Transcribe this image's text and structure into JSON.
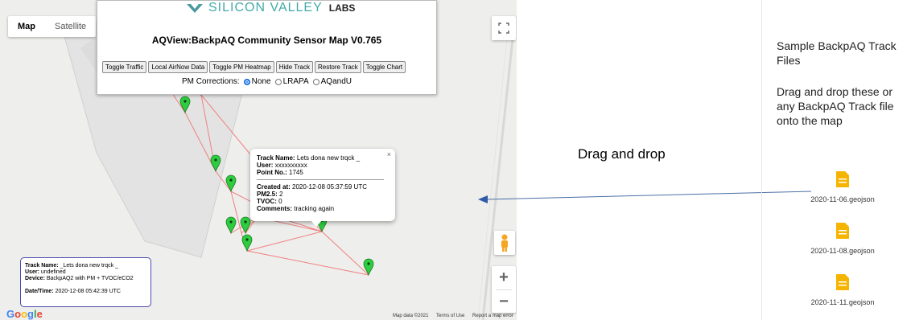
{
  "map": {
    "map_type_tabs": [
      {
        "label": "Map",
        "active": true
      },
      {
        "label": "Satellite",
        "active": false
      }
    ],
    "logo": {
      "brand": "SILICON VALLEY",
      "labs": "LABS"
    },
    "control_panel": {
      "title": "AQView:BackpAQ Community Sensor Map V0.765",
      "buttons": [
        "Toggle Traffic",
        "Local AirNow Data",
        "Toggle PM Heatmap",
        "Hide Track",
        "Restore Track",
        "Toggle Chart"
      ],
      "corrections_label": "PM Corrections:",
      "corrections_options": [
        {
          "label": "None",
          "selected": true
        },
        {
          "label": "LRAPA",
          "selected": false
        },
        {
          "label": "AQandU",
          "selected": false
        }
      ]
    },
    "info_window": {
      "close": "×",
      "track_name_label": "Track Name:",
      "track_name": "Lets dona new trqck _",
      "user_label": "User:",
      "user": "xxxxxxxxxx",
      "point_label": "Point No.:",
      "point": "1745",
      "created_label": "Created at:",
      "created": "2020-12-08 05:37:59 UTC",
      "pm25_label": "PM2.5:",
      "pm25": "2",
      "tvoc_label": "TVOC:",
      "tvoc": "0",
      "comments_label": "Comments:",
      "comments": "tracking again"
    },
    "info_box": {
      "track_name_label": "Track Name:",
      "track_name": "_Lets dona new trqck _",
      "user_label": "User:",
      "user": "undefined",
      "device_label": "Device:",
      "device": "BackpAQ2 with PM + TVOC/eCO2",
      "datetime_label": "Date/Time:",
      "datetime": "2020-12-08 05:42:39 UTC"
    },
    "zoom_in": "+",
    "zoom_out": "−",
    "google_logo": "Google",
    "footer": [
      "Map data ©2021",
      "Terms of Use",
      "Report a map error"
    ],
    "colors": {
      "track_line": "#f08080",
      "marker": "#2ecc40",
      "google_blue": "#4285f4"
    }
  },
  "annotation": {
    "drag_text": "Drag and drop"
  },
  "sidebar": {
    "title": "Sample BackpAQ Track Files",
    "description": "Drag and drop these or any BackpAQ Track file onto the map",
    "files": [
      "2020-11-06.geojson",
      "2020-11-08.geojson",
      "2020-11-11.geojson"
    ],
    "file_icon": "document-icon",
    "file_color": "#f4b400"
  }
}
